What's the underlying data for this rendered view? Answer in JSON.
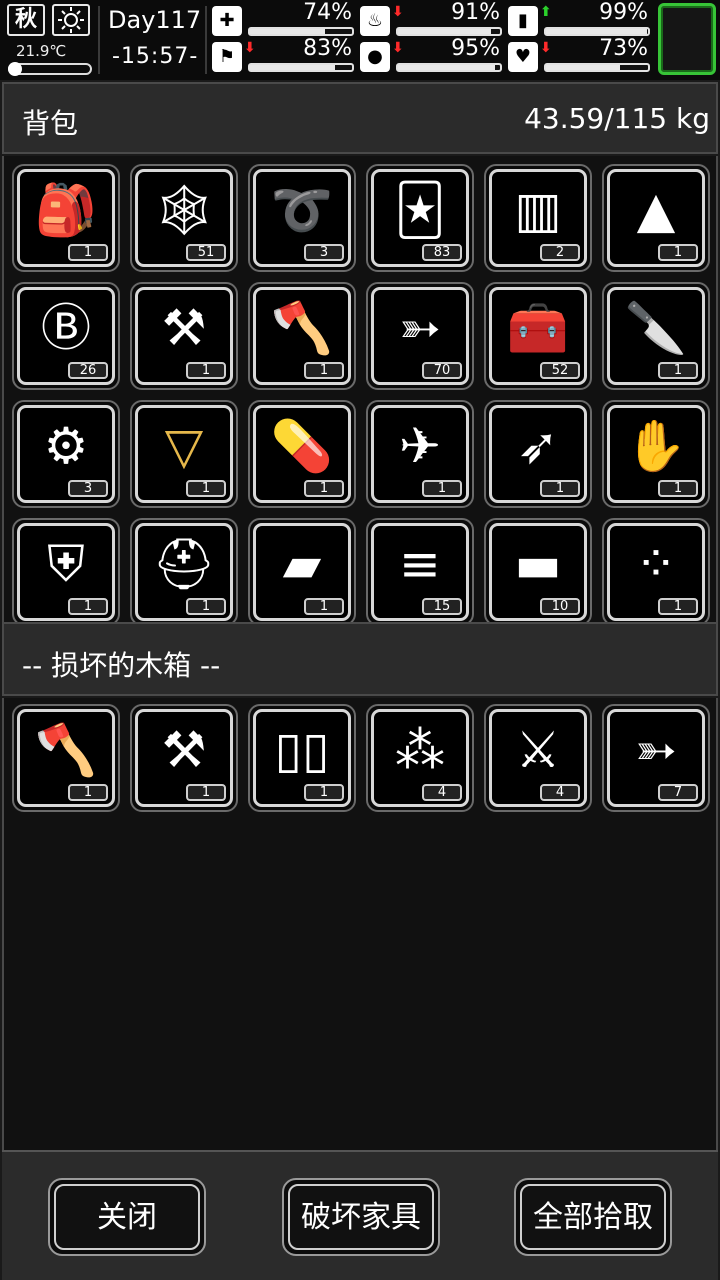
{
  "status": {
    "season": "秋",
    "weather_icon": "sun-icon",
    "temperature": "21.9℃",
    "day": "Day117",
    "clock": "-15:57-",
    "temp_level": 0.1,
    "stats": [
      {
        "name": "health",
        "icon": "medkit-icon",
        "glyph": "✚",
        "value": "74%",
        "level": 0.74,
        "trend": ""
      },
      {
        "name": "hunger",
        "icon": "stomach-icon",
        "glyph": "♨",
        "value": "91%",
        "level": 0.91,
        "trend": "down"
      },
      {
        "name": "energy",
        "icon": "battery-icon",
        "glyph": "▮",
        "value": "99%",
        "level": 0.99,
        "trend": "up"
      },
      {
        "name": "stamina",
        "icon": "foot-icon",
        "glyph": "⚑",
        "value": "83%",
        "level": 0.83,
        "trend": "down"
      },
      {
        "name": "thirst",
        "icon": "water-drop-icon",
        "glyph": "●",
        "value": "95%",
        "level": 0.95,
        "trend": "down"
      },
      {
        "name": "mood",
        "icon": "heart-icon",
        "glyph": "♥",
        "value": "73%",
        "level": 0.73,
        "trend": "down"
      }
    ],
    "arrow_down": "⬇",
    "arrow_up": "⬆"
  },
  "backpack": {
    "title": "背包",
    "weight": "43.59/115 kg",
    "items": [
      {
        "icon": "backpack-icon",
        "glyph": "🎒",
        "count": "1"
      },
      {
        "icon": "net-icon",
        "glyph": "🕸",
        "count": "51"
      },
      {
        "icon": "rope-icon",
        "glyph": "➰",
        "count": "3"
      },
      {
        "icon": "zombie-card-icon",
        "glyph": "🃏",
        "count": "83"
      },
      {
        "icon": "towel-icon",
        "glyph": "▥",
        "count": "2"
      },
      {
        "icon": "torn-cloth-icon",
        "glyph": "▲",
        "count": "1"
      },
      {
        "icon": "coin-icon",
        "glyph": "Ⓑ",
        "count": "26"
      },
      {
        "icon": "shovel-icon",
        "glyph": "⚒",
        "count": "1"
      },
      {
        "icon": "axe-icon",
        "glyph": "🪓",
        "count": "1"
      },
      {
        "icon": "arrow-icon",
        "glyph": "➳",
        "count": "70"
      },
      {
        "icon": "toolbox-icon",
        "glyph": "🧰",
        "count": "52"
      },
      {
        "icon": "knife-icon",
        "glyph": "🔪",
        "count": "1"
      },
      {
        "icon": "parts-box-icon",
        "glyph": "⚙",
        "count": "3"
      },
      {
        "icon": "water-glass-icon",
        "glyph": "▽",
        "count": "1"
      },
      {
        "icon": "pills-icon",
        "glyph": "💊",
        "count": "1"
      },
      {
        "icon": "crossbow-icon",
        "glyph": "✈",
        "count": "1"
      },
      {
        "icon": "spear-icon",
        "glyph": "➶",
        "count": "1"
      },
      {
        "icon": "glove-icon",
        "glyph": "✋",
        "count": "1"
      },
      {
        "icon": "vest-icon",
        "glyph": "⛨",
        "count": "1"
      },
      {
        "icon": "helmet-icon",
        "glyph": "⛑",
        "count": "1"
      },
      {
        "icon": "bandage-roll-icon",
        "glyph": "▰",
        "count": "1"
      },
      {
        "icon": "logs-icon",
        "glyph": "≡",
        "count": "15"
      },
      {
        "icon": "plank-icon",
        "glyph": "▬",
        "count": "10"
      },
      {
        "icon": "seeds-icon",
        "glyph": "⁘",
        "count": "1"
      }
    ]
  },
  "container": {
    "title": "-- 损坏的木箱 --",
    "items": [
      {
        "icon": "axe-icon",
        "glyph": "🪓",
        "count": "1"
      },
      {
        "icon": "shovel-icon",
        "glyph": "⚒",
        "count": "1"
      },
      {
        "icon": "bullets-icon",
        "glyph": "▯▯",
        "count": "1"
      },
      {
        "icon": "pellets-icon",
        "glyph": "⁂",
        "count": "4"
      },
      {
        "icon": "folding-knife-icon",
        "glyph": "⚔",
        "count": "4"
      },
      {
        "icon": "arrow-icon",
        "glyph": "➳",
        "count": "7"
      }
    ]
  },
  "buttons": {
    "close": "关闭",
    "destroy": "破坏家具",
    "take_all": "全部拾取"
  }
}
